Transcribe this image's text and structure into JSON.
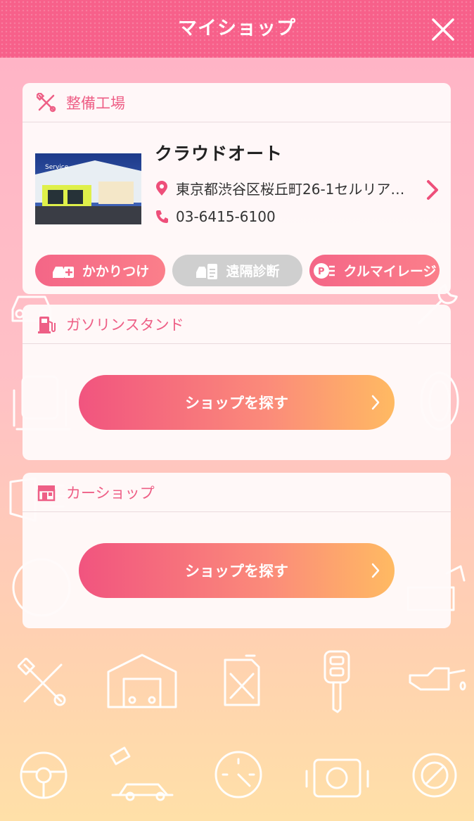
{
  "header": {
    "title": "マイショップ"
  },
  "sections": {
    "maintenance": {
      "label": "整備工場",
      "shop": {
        "name": "クラウドオート",
        "address": "東京都渋谷区桜丘町26-1セルリア…",
        "phone": "03-6415-6100",
        "photo_sign": "Service"
      },
      "badges": [
        {
          "label": "かかりつけ",
          "state": "active"
        },
        {
          "label": "遠隔診断",
          "state": "disabled"
        },
        {
          "label": "クルマイレージ",
          "state": "active"
        }
      ]
    },
    "gas_station": {
      "label": "ガソリンスタンド",
      "button": "ショップを探す"
    },
    "car_shop": {
      "label": "カーショップ",
      "button": "ショップを探す"
    }
  },
  "colors": {
    "accent": "#f7608a",
    "button_start": "#f1547f",
    "button_end": "#ffba62"
  }
}
